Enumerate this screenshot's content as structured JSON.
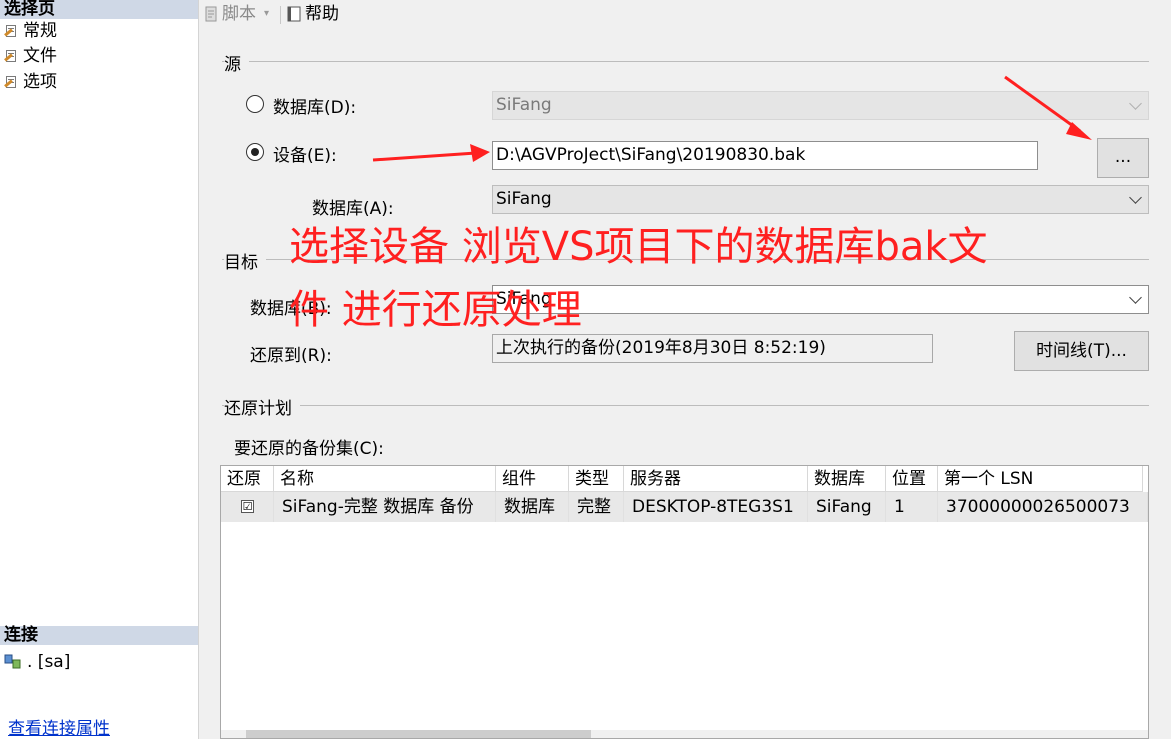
{
  "left_pane": {
    "select_page_header": "选择页",
    "nav_items": [
      {
        "label": "常规"
      },
      {
        "label": "文件"
      },
      {
        "label": "选项"
      }
    ],
    "connection_header": "连接",
    "connection_value": ". [sa]",
    "view_connection_link": "查看连接属性"
  },
  "toolbar": {
    "script_label": "脚本",
    "help_label": "帮助"
  },
  "source": {
    "group_label": "源",
    "database_radio_label": "数据库(D):",
    "database_value": "SiFang",
    "device_radio_label": "设备(E):",
    "device_path": "D:\\AGVProJect\\SiFang\\20190830.bak",
    "browse_label": "...",
    "device_database_label": "数据库(A):",
    "device_database_value": "SiFang"
  },
  "target": {
    "group_label": "目标",
    "database_label": "数据库(B):",
    "database_value": "SiFang",
    "restore_to_label": "还原到(R):",
    "restore_to_value": "上次执行的备份(2019年8月30日 8:52:19)",
    "timeline_label": "时间线(T)..."
  },
  "plan": {
    "group_label": "还原计划",
    "backup_sets_label": "要还原的备份集(C):",
    "columns": [
      "还原",
      "名称",
      "组件",
      "类型",
      "服务器",
      "数据库",
      "位置",
      "第一个 LSN"
    ],
    "rows": [
      {
        "restore": "☑",
        "name": "SiFang-完整 数据库 备份",
        "component": "数据库",
        "type": "完整",
        "server": "DESKTOP-8TEG3S1",
        "database": "SiFang",
        "position": "1",
        "first_lsn": "37000000026500073"
      }
    ]
  },
  "annotation": {
    "line1": "选择设备 浏览VS项目下的数据库bak文",
    "line2": "件 进行还原处理",
    "color": "#ff2020"
  }
}
